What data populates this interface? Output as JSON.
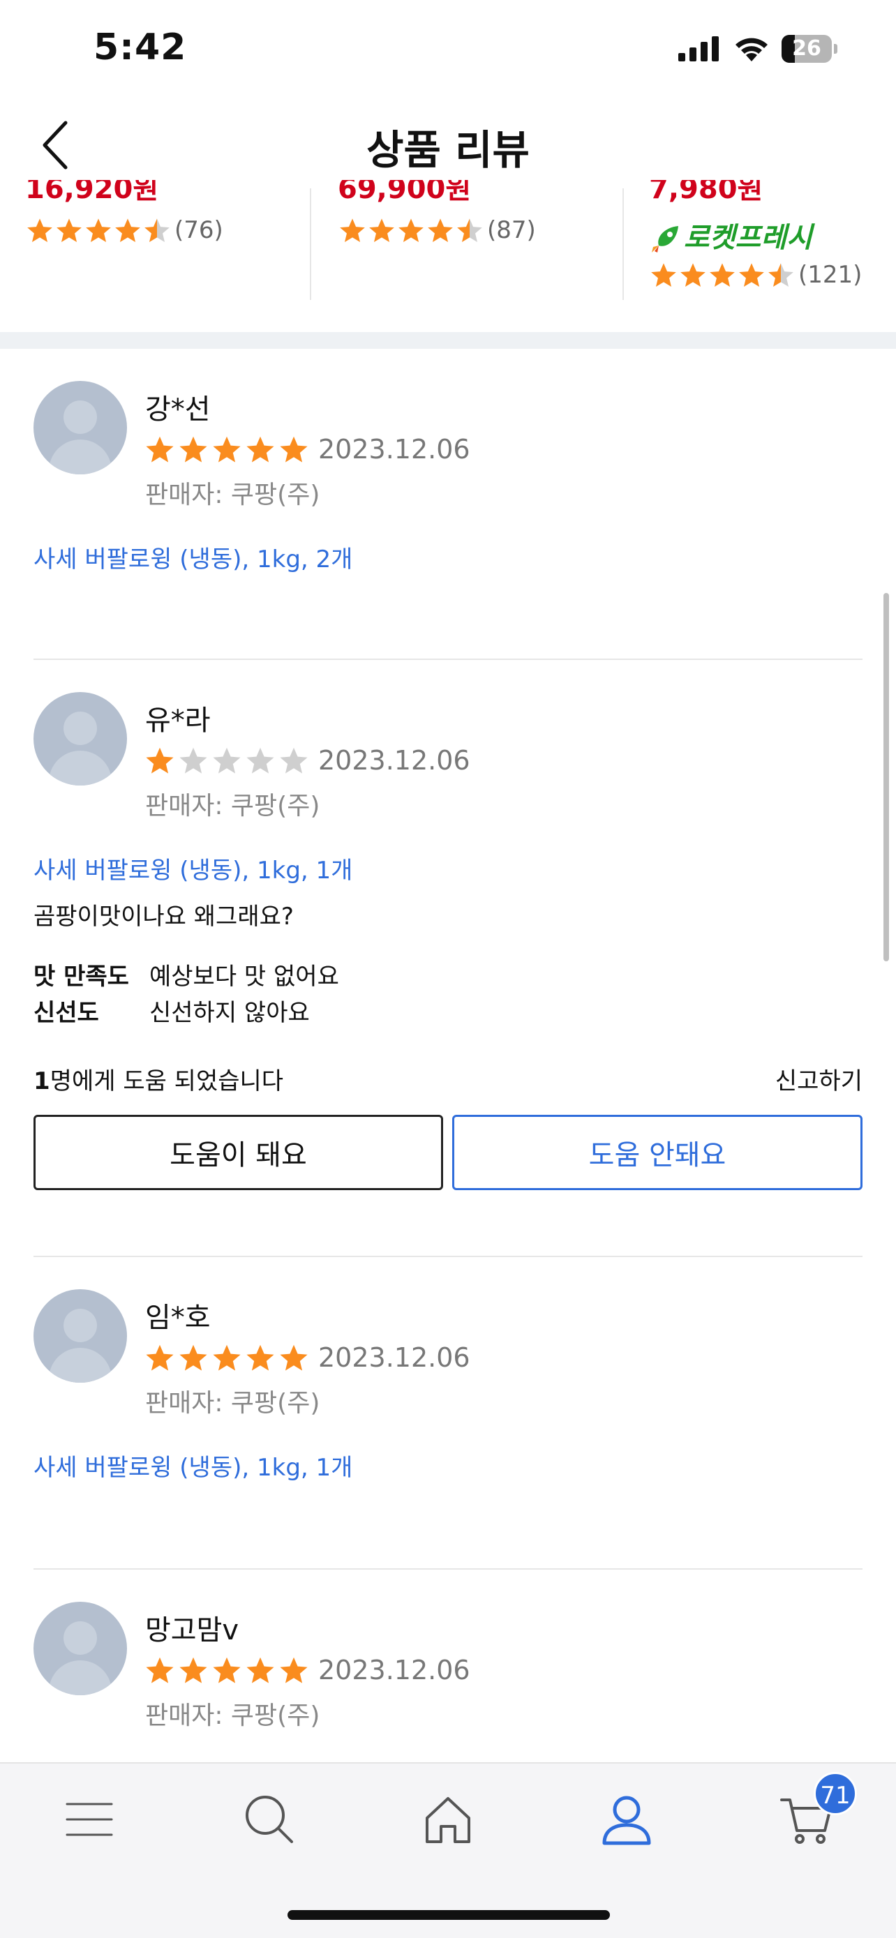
{
  "status_bar": {
    "time": "5:42",
    "battery_level": "26",
    "icons": [
      "signal-icon",
      "wifi-icon",
      "battery-icon"
    ]
  },
  "header": {
    "title": "상품 리뷰",
    "back_icon": "chevron-left-icon"
  },
  "related_products": [
    {
      "price": "16,920원",
      "rating": 4.5,
      "review_count": "(76)",
      "badge": ""
    },
    {
      "price": "69,900원",
      "rating": 4.5,
      "review_count": "(87)",
      "badge": ""
    },
    {
      "price": "7,980원",
      "rating": 4.5,
      "review_count": "(121)",
      "badge": "로켓프레시"
    }
  ],
  "reviews": [
    {
      "name": "강*선",
      "rating": 5,
      "date": "2023.12.06",
      "seller": "판매자: 쿠팡(주)",
      "option": "사세 버팔로윙 (냉동), 1kg, 2개"
    },
    {
      "name": "유*라",
      "rating": 1,
      "date": "2023.12.06",
      "seller": "판매자: 쿠팡(주)",
      "option": "사세 버팔로윙 (냉동), 1kg, 1개",
      "text": "곰팡이맛이나요 왜그래요?",
      "survey": [
        {
          "label": "맛 만족도",
          "value": "예상보다 맛 없어요"
        },
        {
          "label": "신선도",
          "value": "신선하지 않아요"
        }
      ],
      "helpful_count": "1",
      "helpful_suffix": "명에게 도움 되었습니다",
      "report_label": "신고하기",
      "helpful_button": "도움이 돼요",
      "not_helpful_button": "도움 안돼요"
    },
    {
      "name": "임*호",
      "rating": 5,
      "date": "2023.12.06",
      "seller": "판매자: 쿠팡(주)",
      "option": "사세 버팔로윙 (냉동), 1kg, 1개"
    },
    {
      "name": "망고맘v",
      "rating": 5,
      "date": "2023.12.06",
      "seller": "판매자: 쿠팡(주)"
    }
  ],
  "bottom_nav": {
    "items": [
      "menu-icon",
      "search-icon",
      "home-icon",
      "profile-icon",
      "cart-icon"
    ],
    "active": "profile-icon",
    "cart_badge": "71"
  },
  "colors": {
    "star": "#fa8c1e",
    "star_empty": "#cfcfcf",
    "link_blue": "#2f6ddb",
    "price_red": "#d0021b",
    "rocket_green": "#1f9d2a"
  }
}
